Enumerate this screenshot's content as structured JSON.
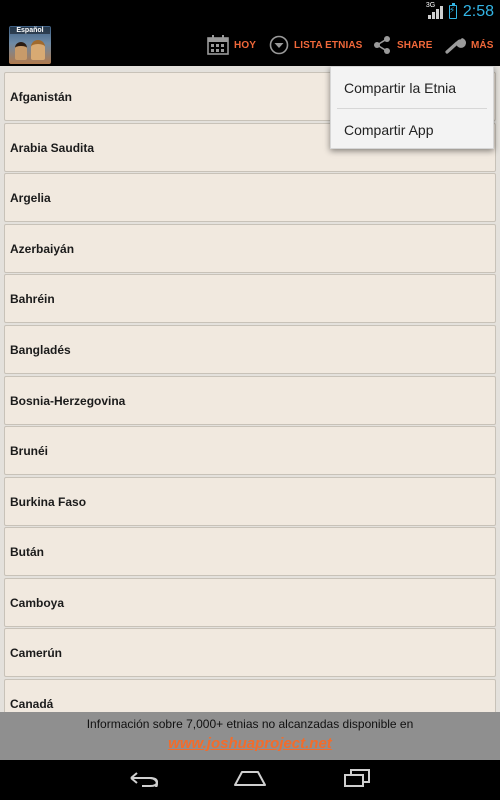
{
  "status_bar": {
    "network": "3G",
    "time": "2:58"
  },
  "app": {
    "logo_label": "Español"
  },
  "action_bar": {
    "hoy": "HOY",
    "lista": "LISTA ETNIAS",
    "share": "SHARE",
    "mas": "MÁS"
  },
  "overflow_menu": {
    "items": [
      {
        "label": "Compartir la Etnia"
      },
      {
        "label": "Compartir App"
      }
    ]
  },
  "countries": [
    "Afganistán",
    "Arabia Saudita",
    "Argelia",
    "Azerbaiyán",
    "Bahréin",
    "Bangladés",
    "Bosnia-Herzegovina",
    "Brunéi",
    "Burkina Faso",
    "Bután",
    "Camboya",
    "Camerún",
    "Canadá"
  ],
  "footer": {
    "text": "Información sobre 7,000+ etnias no alcanzadas disponible en",
    "link": "www.joshuaproject.net"
  },
  "colors": {
    "accent": "#f0683a",
    "clock": "#33b5e5",
    "list_item_bg": "#f1e9df",
    "footer_bg": "#8f8f8f"
  },
  "icons": {
    "hoy": "calendar-icon",
    "lista": "dropdown-circle-icon",
    "share": "share-icon",
    "mas": "wrench-icon",
    "back": "back-arrow-icon",
    "home": "home-icon",
    "recents": "recents-icon"
  }
}
